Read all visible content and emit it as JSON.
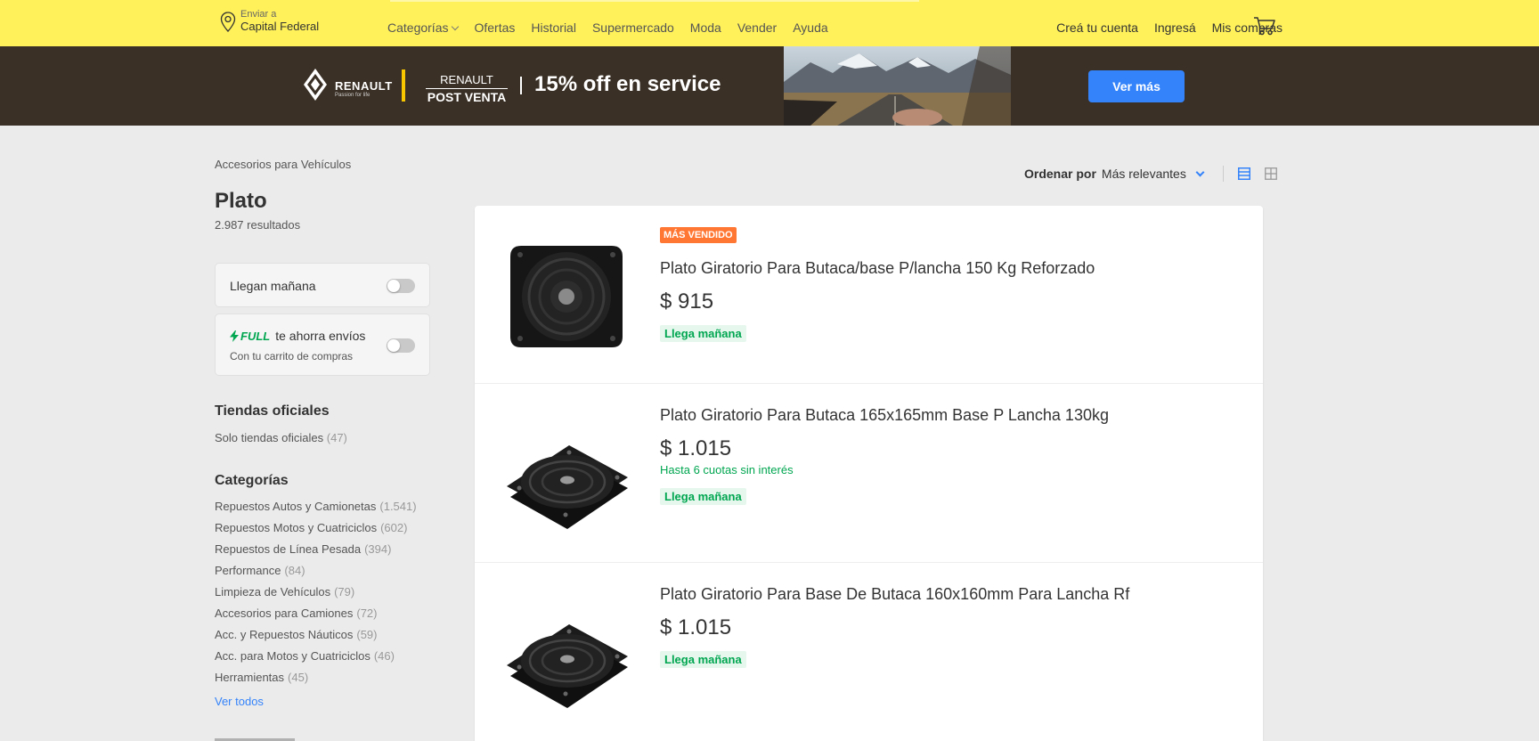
{
  "header": {
    "location": {
      "line1": "Enviar a",
      "line2": "Capital Federal"
    },
    "nav": [
      "Categorías",
      "Ofertas",
      "Historial",
      "Supermercado",
      "Moda",
      "Vender",
      "Ayuda"
    ],
    "account": [
      "Creá tu cuenta",
      "Ingresá",
      "Mis compras"
    ],
    "icons": {
      "location": "pin-icon",
      "cart": "cart-icon",
      "dropdown": "chevron-down-icon"
    },
    "colors": {
      "bar": "#fff159"
    }
  },
  "banner": {
    "brand": "RENAULT",
    "tagline": "Passion for life",
    "postventa_top": "RENAULT",
    "postventa_bottom": "POST VENTA",
    "offer": "15% off en service",
    "button": "Ver más",
    "colors": {
      "background": "#3b3025",
      "accent": "#f7c600",
      "button": "#3483fa"
    }
  },
  "sidebar": {
    "breadcrumb": "Accesorios para Vehículos",
    "title": "Plato",
    "results": "2.987 resultados",
    "filters": {
      "llegan": "Llegan mañana",
      "full_brand": "FULL",
      "full_text": "te ahorra envíos",
      "full_sub": "Con tu carrito de compras",
      "llegan_on": false,
      "full_on": false
    },
    "tiendas": {
      "heading": "Tiendas oficiales",
      "link": "Solo tiendas oficiales",
      "count": "(47)"
    },
    "categorias": {
      "heading": "Categorías",
      "items": [
        {
          "label": "Repuestos Autos y Camionetas",
          "count": "(1.541)"
        },
        {
          "label": "Repuestos Motos y Cuatriciclos",
          "count": "(602)"
        },
        {
          "label": "Repuestos de Línea Pesada",
          "count": "(394)"
        },
        {
          "label": "Performance",
          "count": "(84)"
        },
        {
          "label": "Limpieza de Vehículos",
          "count": "(79)"
        },
        {
          "label": "Accesorios para Camiones",
          "count": "(72)"
        },
        {
          "label": "Acc. y Repuestos Náuticos",
          "count": "(59)"
        },
        {
          "label": "Acc. para Motos y Cuatriciclos",
          "count": "(46)"
        },
        {
          "label": "Herramientas",
          "count": "(45)"
        }
      ],
      "ver_todos": "Ver todos"
    }
  },
  "sort": {
    "label": "Ordenar por",
    "value": "Más relevantes",
    "view_icons": [
      "list-view-icon",
      "grid-view-icon"
    ],
    "active_view": "list"
  },
  "items": [
    {
      "badge": "MÁS VENDIDO",
      "title": "Plato Giratorio Para Butaca/base P/lancha 150 Kg Reforzado",
      "price": "$ 915",
      "cuotas": "",
      "shipping": "Llega mañana"
    },
    {
      "badge": "",
      "title": "Plato Giratorio Para Butaca 165x165mm Base P Lancha 130kg",
      "price": "$ 1.015",
      "cuotas": "Hasta 6 cuotas sin interés",
      "shipping": "Llega mañana"
    },
    {
      "badge": "",
      "title": "Plato Giratorio Para Base De Butaca 160x160mm Para Lancha Rf",
      "price": "$ 1.015",
      "cuotas": "",
      "shipping": "Llega mañana"
    }
  ]
}
